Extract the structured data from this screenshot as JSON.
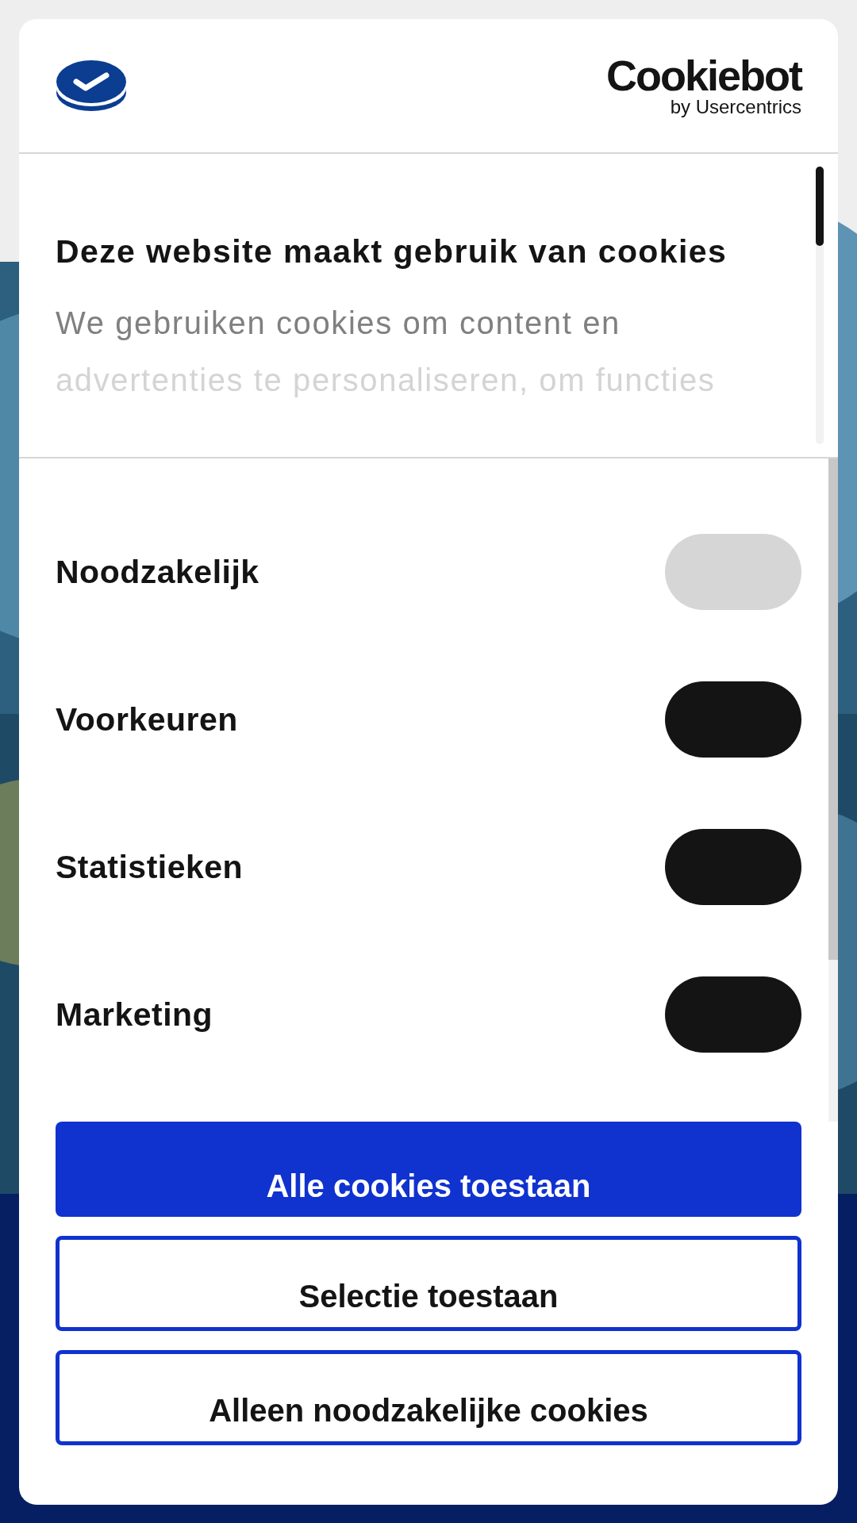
{
  "dialog": {
    "logo": {
      "name": "Cookiebot",
      "tagline": "by Usercentrics"
    },
    "title": "Deze website maakt gebruik van cookies",
    "description_lines": [
      "We gebruiken cookies om content en",
      "advertenties te personaliseren, om functies"
    ],
    "categories": [
      {
        "label": "Noodzakelijk",
        "checked": true,
        "disabled": true
      },
      {
        "label": "Voorkeuren",
        "checked": true,
        "disabled": false
      },
      {
        "label": "Statistieken",
        "checked": true,
        "disabled": false
      },
      {
        "label": "Marketing",
        "checked": true,
        "disabled": false
      }
    ],
    "buttons": [
      {
        "label": "Alle cookies toestaan",
        "kind": "primary"
      },
      {
        "label": "Selectie toestaan",
        "kind": "outline"
      },
      {
        "label": "Alleen noodzakelijke cookies",
        "kind": "outline"
      }
    ]
  }
}
